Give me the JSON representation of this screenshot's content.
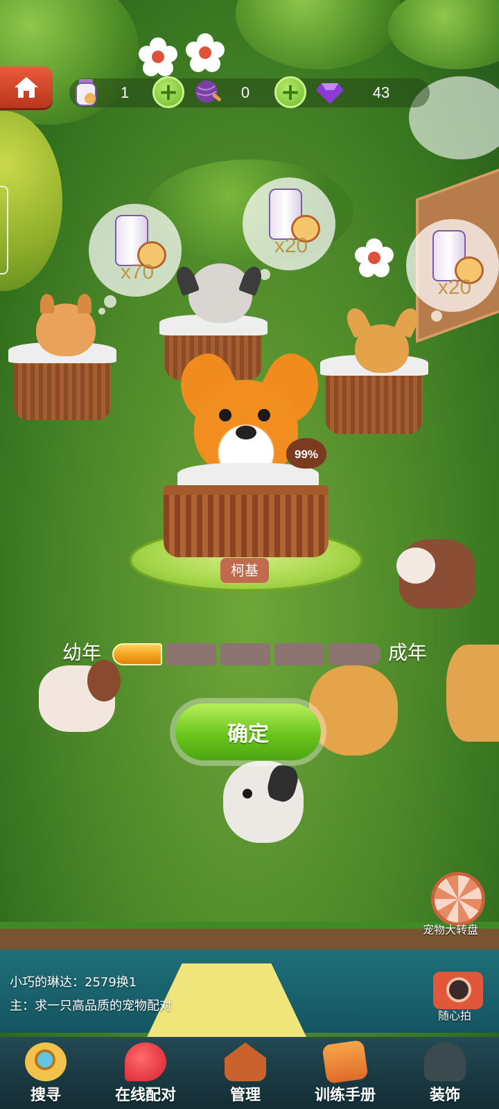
{
  "top_bar": {
    "potions_count": "1",
    "yarn_count": "0",
    "gems_count": "43"
  },
  "bubbles": [
    {
      "qty": "x70"
    },
    {
      "qty": "x20"
    },
    {
      "qty": "x20"
    }
  ],
  "pet": {
    "name": "柯基",
    "percent": "99%"
  },
  "growth": {
    "start_label": "幼年",
    "end_label": "成年",
    "filled_segments": 1,
    "total_segments": 5
  },
  "confirm_label": "确定",
  "side": {
    "wheel_label": "宠物大转盘",
    "camera_label": "随心拍"
  },
  "chat": {
    "line1": "小巧的琳达：2579换1",
    "line2": "主：求一只高品质的宠物配对"
  },
  "nav": [
    {
      "label": "搜寻",
      "icon": "search-icon"
    },
    {
      "label": "在线配对",
      "icon": "heart-match-icon"
    },
    {
      "label": "管理",
      "icon": "doghouse-icon"
    },
    {
      "label": "训练手册",
      "icon": "book-icon"
    },
    {
      "label": "装饰",
      "icon": "tree-icon"
    }
  ],
  "colors": {
    "grass": "#4f8a2a",
    "confirm_green": "#6cc51c",
    "growth_fill": "#f3a11f",
    "nav_bg": "#234a55"
  }
}
